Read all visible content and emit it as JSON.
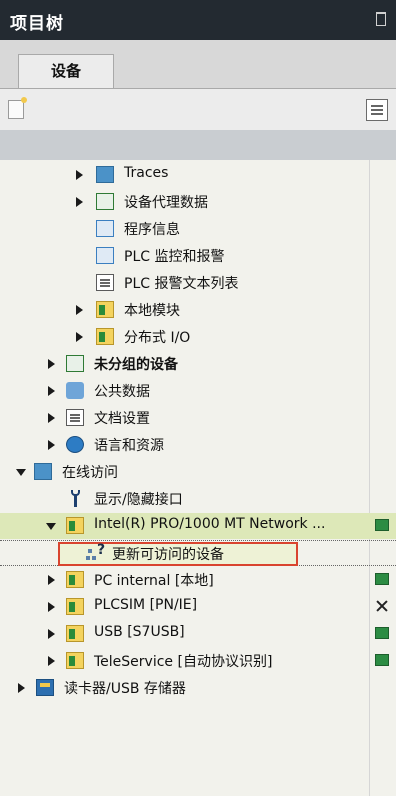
{
  "panel": {
    "title": "项目树"
  },
  "tabs": [
    {
      "label": "设备"
    }
  ],
  "tree": [
    {
      "key": "traces",
      "label": "Traces",
      "level": 3,
      "toggle": "collapsed",
      "icon": "trace-folder-icon",
      "bold": false
    },
    {
      "key": "device-proxy",
      "label": "设备代理数据",
      "level": 3,
      "toggle": "collapsed",
      "icon": "proxy-data-icon",
      "bold": false
    },
    {
      "key": "program-info",
      "label": "程序信息",
      "level": 3,
      "toggle": "none",
      "icon": "program-info-icon",
      "bold": false
    },
    {
      "key": "plc-alarm",
      "label": "PLC 监控和报警",
      "level": 3,
      "toggle": "none",
      "icon": "plc-alarm-icon",
      "bold": false
    },
    {
      "key": "plc-alarm-text",
      "label": "PLC 报警文本列表",
      "level": 3,
      "toggle": "none",
      "icon": "alarm-text-icon",
      "bold": false
    },
    {
      "key": "local-modules",
      "label": "本地模块",
      "level": 3,
      "toggle": "collapsed",
      "icon": "module-folder-icon",
      "bold": false
    },
    {
      "key": "distributed-io",
      "label": "分布式 I/O",
      "level": 3,
      "toggle": "collapsed",
      "icon": "io-folder-icon",
      "bold": false
    },
    {
      "key": "ungrouped",
      "label": "未分组的设备",
      "level": 1,
      "toggle": "collapsed",
      "icon": "ungrouped-devices-icon",
      "bold": true
    },
    {
      "key": "common-data",
      "label": "公共数据",
      "level": 1,
      "toggle": "collapsed",
      "icon": "common-data-icon",
      "bold": false
    },
    {
      "key": "doc-settings",
      "label": "文档设置",
      "level": 1,
      "toggle": "collapsed",
      "icon": "document-settings-icon",
      "bold": false
    },
    {
      "key": "languages",
      "label": "语言和资源",
      "level": 1,
      "toggle": "collapsed",
      "icon": "language-globe-icon",
      "bold": false
    },
    {
      "key": "online-access",
      "label": "在线访问",
      "level": 0,
      "toggle": "expanded",
      "icon": "online-access-icon",
      "bold": false
    },
    {
      "key": "show-hidden",
      "label": "显示/隐藏接口",
      "level": 1,
      "toggle": "none",
      "icon": "wrench-icon",
      "bold": false
    },
    {
      "key": "intel-nic",
      "label": "Intel(R) PRO/1000 MT Network ...",
      "level": 1,
      "toggle": "expanded",
      "icon": "network-adapter-icon",
      "bold": false,
      "status": "connected-status-icon",
      "highlight": true
    },
    {
      "key": "update-accessible",
      "label": "更新可访问的设备",
      "level": 2,
      "toggle": "none",
      "icon": "update-devices-icon",
      "bold": false,
      "selected": true
    },
    {
      "key": "pc-internal",
      "label": "PC internal [本地]",
      "level": 1,
      "toggle": "collapsed",
      "icon": "pc-folder-icon",
      "bold": false,
      "status": "connected-status-icon"
    },
    {
      "key": "plcsim",
      "label": "PLCSIM [PN/IE]",
      "level": 1,
      "toggle": "collapsed",
      "icon": "plcsim-folder-icon",
      "bold": false,
      "status": "disconnected-status-icon"
    },
    {
      "key": "usb",
      "label": "USB [S7USB]",
      "level": 1,
      "toggle": "collapsed",
      "icon": "usb-folder-icon",
      "bold": false,
      "status": "connected-status-icon"
    },
    {
      "key": "teleservice",
      "label": "TeleService [自动协议识别]",
      "level": 1,
      "toggle": "collapsed",
      "icon": "teleservice-folder-icon",
      "bold": false,
      "status": "connected-status-icon"
    },
    {
      "key": "card-reader",
      "label": "读卡器/USB 存储器",
      "level": 0,
      "toggle": "collapsed",
      "icon": "card-reader-icon",
      "bold": false
    }
  ]
}
